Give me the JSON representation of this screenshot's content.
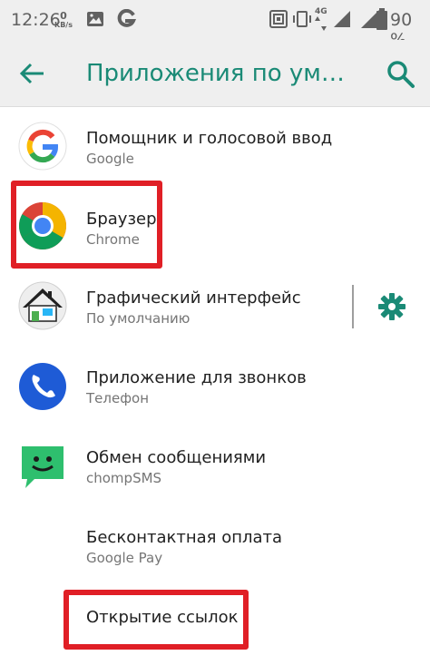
{
  "status_bar": {
    "time": "12:26",
    "net_speed_value": "0",
    "net_speed_unit": "KB/s",
    "network_type": "4G",
    "battery_percent": "90 %",
    "icons": [
      "image-icon",
      "g-icon",
      "nfc-icon",
      "vibrate-icon",
      "signal-icon",
      "battery-icon"
    ]
  },
  "app_bar": {
    "back_icon": "arrow-left-icon",
    "title": "Приложения по умолчанию",
    "search_icon": "search-icon",
    "accent_color": "#1a8a76"
  },
  "items": [
    {
      "label": "Помощник и голосовой ввод",
      "sub": "Google",
      "icon": "google-icon"
    },
    {
      "label": "Браузер",
      "sub": "Chrome",
      "icon": "chrome-icon"
    },
    {
      "label": "Графический интерфейс",
      "sub": "По умолчанию",
      "icon": "launcher-home-icon",
      "action_icon": "gear-icon"
    },
    {
      "label": "Приложение для звонков",
      "sub": "Телефон",
      "icon": "phone-icon"
    },
    {
      "label": "Обмен сообщениями",
      "sub": "chompSMS",
      "icon": "chompsms-icon"
    },
    {
      "label": "Бесконтактная оплата",
      "sub": "Google Pay"
    },
    {
      "label": "Открытие ссылок"
    }
  ],
  "highlight_color": "#e01f26"
}
